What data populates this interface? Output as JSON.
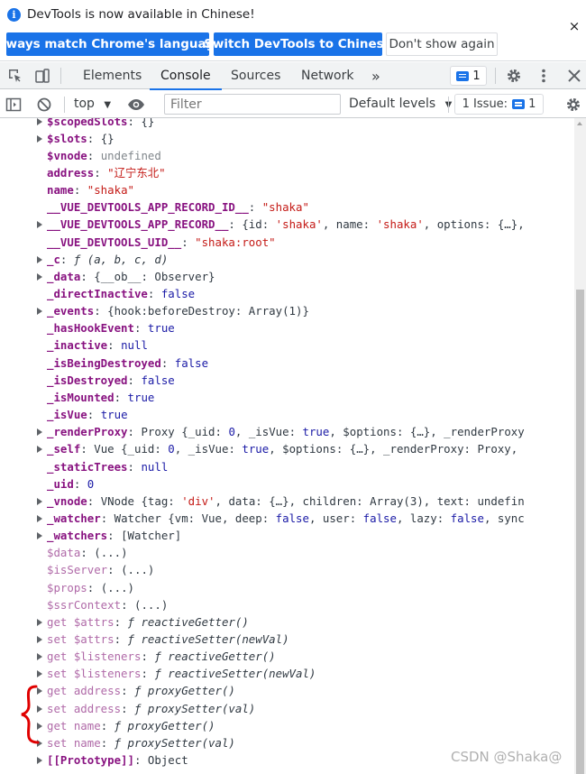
{
  "infobar": {
    "message": "DevTools is now available in Chinese!",
    "btn_match": "Always match Chrome's language",
    "btn_switch": "Switch DevTools to Chinese",
    "btn_dont": "Don't show again",
    "close": "×"
  },
  "tabs": {
    "elements": "Elements",
    "console": "Console",
    "sources": "Sources",
    "network": "Network",
    "more": "»",
    "msg_count": "1"
  },
  "console_toolbar": {
    "context": "top",
    "filter_placeholder": "Filter",
    "levels": "Default levels",
    "issues_label": "1 Issue:",
    "issues_count": "1"
  },
  "colors": {
    "accent": "#1a73e8",
    "own_prop": "#881280",
    "string": "#c41a16",
    "keyword": "#1a1aa6"
  },
  "lines": [
    {
      "k": "$scopedSlots",
      "v": "{}"
    },
    {
      "k": "$slots",
      "v": "{}"
    },
    {
      "k": "$vnode",
      "v": "undefined"
    },
    {
      "k": "address",
      "v": "\"辽宁东北\""
    },
    {
      "k": "name",
      "v": "\"shaka\""
    },
    {
      "k": "__VUE_DEVTOOLS_APP_RECORD_ID__",
      "v": "\"shaka\""
    },
    {
      "k": "__VUE_DEVTOOLS_APP_RECORD__",
      "v_parts": [
        "{id: ",
        "'shaka'",
        ", name: ",
        "'shaka'",
        ", options: {…},"
      ]
    },
    {
      "k": "__VUE_DEVTOOLS_UID__",
      "v": "\"shaka:root\""
    },
    {
      "k": "_c",
      "v": "ƒ (a, b, c, d)"
    },
    {
      "k": "_data",
      "v": "{__ob__: Observer}"
    },
    {
      "k": "_directInactive",
      "v": "false"
    },
    {
      "k": "_events",
      "v": "{hook:beforeDestroy: Array(1)}"
    },
    {
      "k": "_hasHookEvent",
      "v": "true"
    },
    {
      "k": "_inactive",
      "v": "null"
    },
    {
      "k": "_isBeingDestroyed",
      "v": "false"
    },
    {
      "k": "_isDestroyed",
      "v": "false"
    },
    {
      "k": "_isMounted",
      "v": "true"
    },
    {
      "k": "_isVue",
      "v": "true"
    },
    {
      "k": "_renderProxy",
      "v_parts": [
        "Proxy {_uid: ",
        "0",
        ", _isVue: ",
        "true",
        ", $options: {…}, _renderProxy"
      ]
    },
    {
      "k": "_self",
      "v_parts": [
        "Vue {_uid: ",
        "0",
        ", _isVue: ",
        "true",
        ", $options: {…}, _renderProxy: Proxy,"
      ]
    },
    {
      "k": "_staticTrees",
      "v": "null"
    },
    {
      "k": "_uid",
      "v": "0"
    },
    {
      "k": "_vnode",
      "v_parts": [
        "VNode {tag: ",
        "'div'",
        ", data: {…}, children: Array(3), text: undefin"
      ]
    },
    {
      "k": "_watcher",
      "v_parts": [
        "Watcher {vm: Vue, deep: ",
        "false",
        ", user: ",
        "false",
        ", lazy: ",
        "false",
        ", sync"
      ]
    },
    {
      "k": "_watchers",
      "v": "[Watcher]"
    },
    {
      "k": "$data",
      "v": "(...)"
    },
    {
      "k": "$isServer",
      "v": "(...)"
    },
    {
      "k": "$props",
      "v": "(...)"
    },
    {
      "k": "$ssrContext",
      "v": "(...)"
    },
    {
      "k": "get $attrs",
      "v": "ƒ reactiveGetter()"
    },
    {
      "k": "set $attrs",
      "v": "ƒ reactiveSetter(newVal)"
    },
    {
      "k": "get $listeners",
      "v": "ƒ reactiveGetter()"
    },
    {
      "k": "set $listeners",
      "v": "ƒ reactiveSetter(newVal)"
    },
    {
      "k": "get address",
      "v": "ƒ proxyGetter()"
    },
    {
      "k": "set address",
      "v": "ƒ proxySetter(val)"
    },
    {
      "k": "get name",
      "v": "ƒ proxyGetter()"
    },
    {
      "k": "set name",
      "v": "ƒ proxySetter(val)"
    },
    {
      "k": "[[Prototype]]",
      "v": "Object"
    }
  ],
  "watermark": "CSDN @Shaka@"
}
